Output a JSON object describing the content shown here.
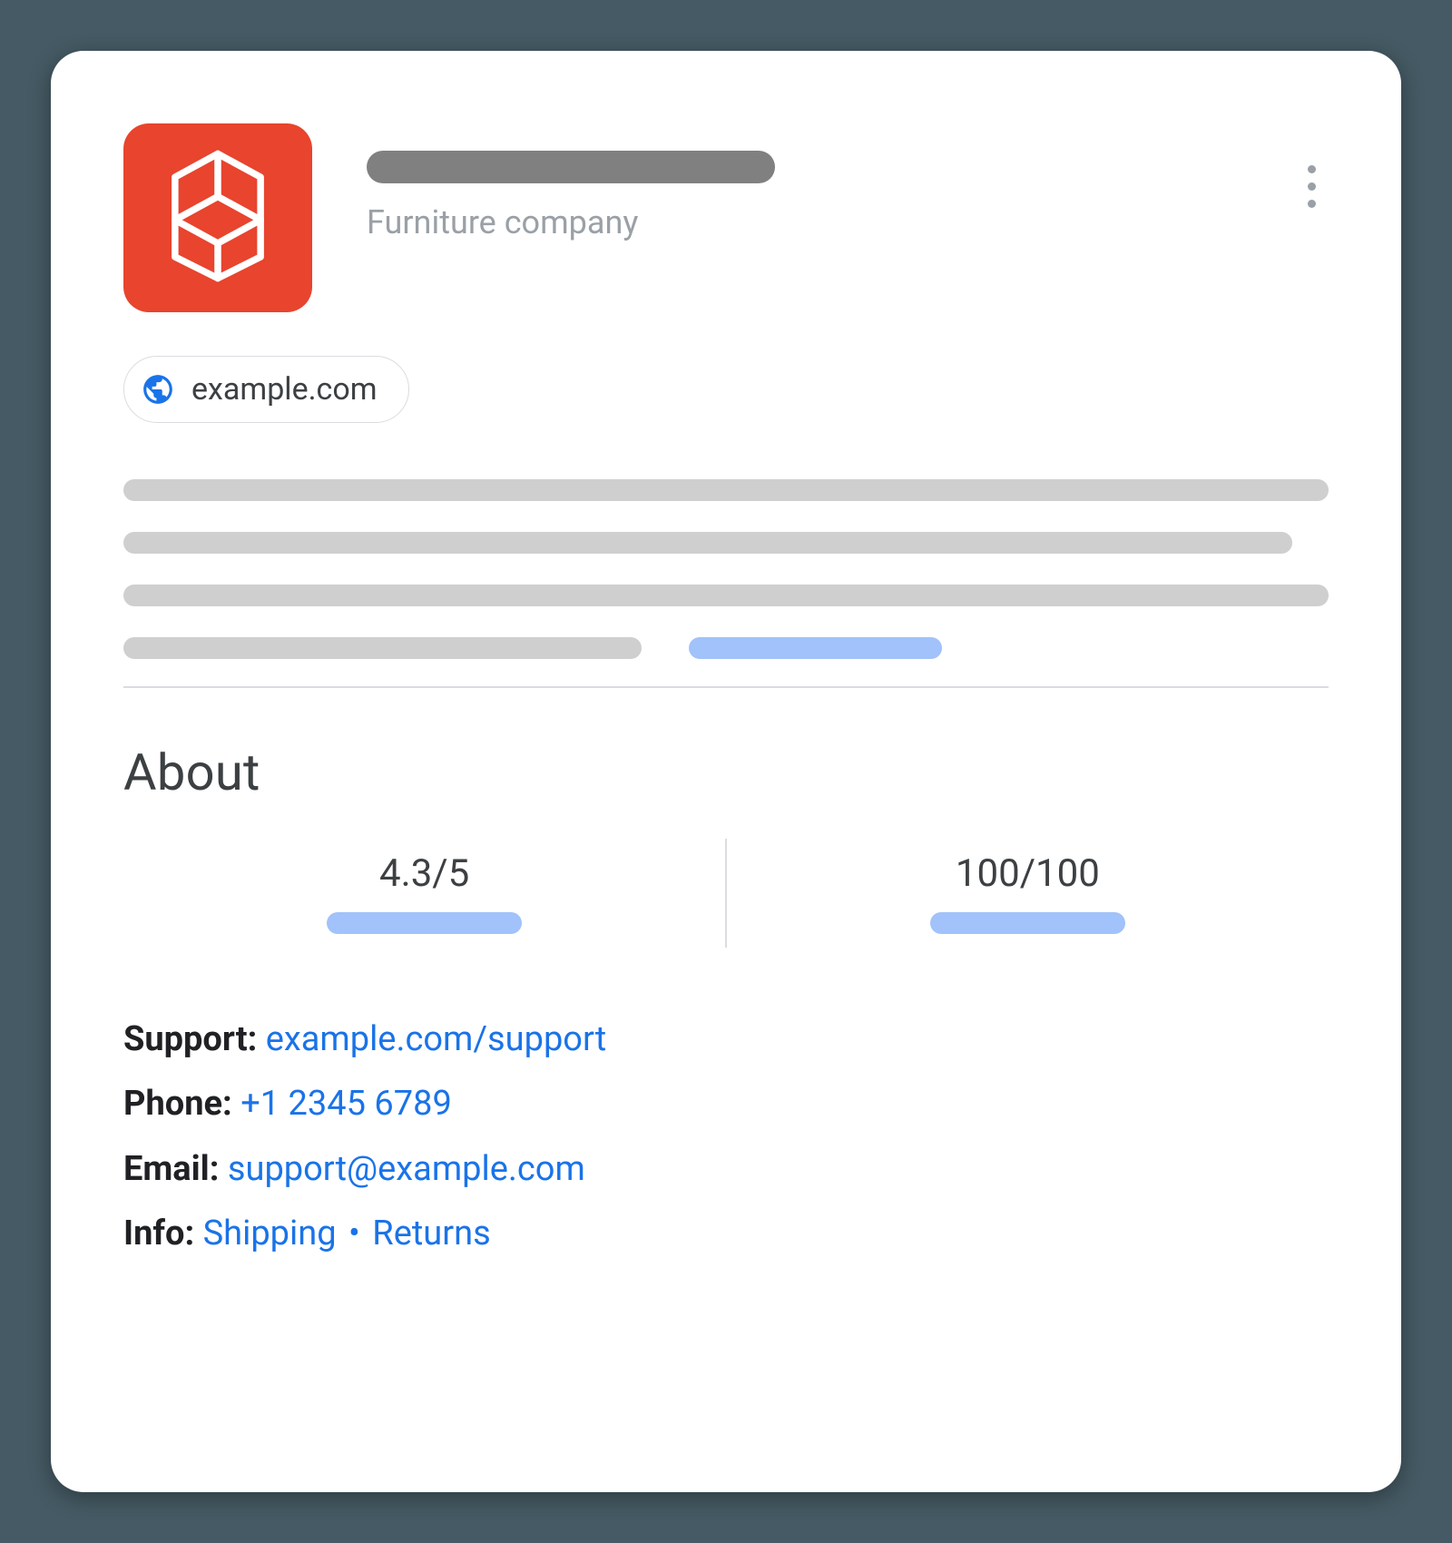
{
  "header": {
    "subtitle": "Furniture company"
  },
  "website": {
    "label": "example.com"
  },
  "about": {
    "title": "About",
    "stat1": "4.3/5",
    "stat2": "100/100"
  },
  "contacts": {
    "support_label": "Support:",
    "support_link": "example.com/support",
    "phone_label": "Phone:",
    "phone_link": "+1 2345 6789",
    "email_label": "Email:",
    "email_link": "support@example.com",
    "info_label": "Info:",
    "info_shipping": "Shipping",
    "info_sep": "•",
    "info_returns": "Returns"
  }
}
